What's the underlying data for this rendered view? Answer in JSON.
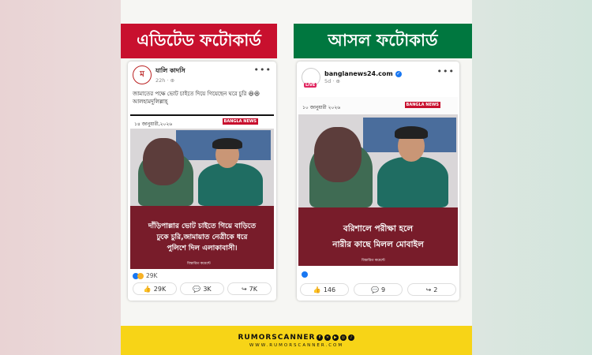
{
  "headers": {
    "left": "এডিটেড ফটোকার্ড",
    "right": "আসল ফটোকার্ড"
  },
  "left_post": {
    "page_name": "যালি কাদসি",
    "meta": "22h · ⊕",
    "caption": "জামাতের পক্ষে ভোট চাইতে দিয়ে গিয়েছেন ঘরে চুরি 😆😆 আলহামদুলিল্লাহ্",
    "date": "১৪ জানুয়ারী,২০২৬",
    "logo": "BANGLA NEWS",
    "headline_lines": [
      "দাঁড়িপাল্লার ভোট চাইতে গিয়ে বাড়িতে",
      "ঢুকে চুরি,জামায়াত নেত্রীকে ধরে",
      "পুলিশে দিল এলাকাবাসী।"
    ],
    "tag": "বিস্তারিত কমেন্টে",
    "reactions": "29K",
    "actions": [
      {
        "icon": "like-icon",
        "label": "29K"
      },
      {
        "icon": "comment-icon",
        "label": "3K"
      },
      {
        "icon": "share-icon",
        "label": "7K"
      }
    ]
  },
  "right_post": {
    "page_name": "banglanews24.com",
    "meta": "5d · ⊕",
    "avatar_label": "LIVE",
    "date": "১০ জানুয়ারী ২০২৬",
    "logo": "BANGLA NEWS",
    "headline_lines": [
      "বরিশালে পরীক্ষা হলে",
      "নারীর কাছে মিলল মোবাইল"
    ],
    "tag": "বিস্তারিত কমেন্টে",
    "actions": [
      {
        "icon": "like-icon",
        "label": "146"
      },
      {
        "icon": "comment-icon",
        "label": "9"
      },
      {
        "icon": "share-icon",
        "label": "2"
      }
    ]
  },
  "footer": {
    "brand": "RUMORSCANNER",
    "url": "WWW.RUMORSCANNER.COM",
    "social": [
      "f",
      "✕",
      "▶",
      "◎",
      "♪"
    ]
  }
}
